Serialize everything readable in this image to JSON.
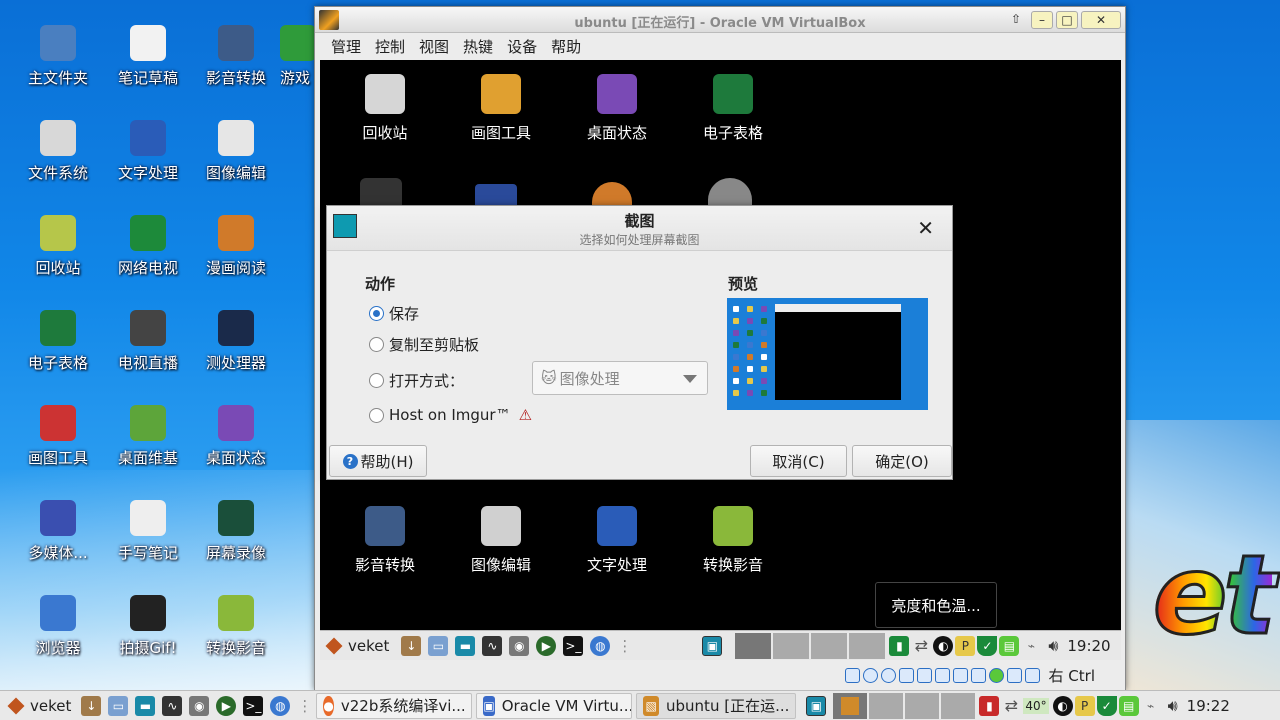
{
  "desktop": {
    "icons": [
      {
        "label": "主文件夹",
        "icon": "home-folder-icon",
        "color": "#4a7fc0"
      },
      {
        "label": "笔记草稿",
        "icon": "notes-icon",
        "color": "#f2f2f2"
      },
      {
        "label": "影音转换",
        "icon": "video-camera-icon",
        "color": "#3d5b88"
      },
      {
        "label": "游戏",
        "icon": "game-icon",
        "color": "#2f9b3a"
      },
      {
        "label": "文件系统",
        "icon": "drive-icon",
        "color": "#d8d8d8"
      },
      {
        "label": "文字处理",
        "icon": "word-icon",
        "color": "#2a5cb8"
      },
      {
        "label": "图像编辑",
        "icon": "paint-icon",
        "color": "#e6e6e6"
      },
      {
        "label": "回收站",
        "icon": "trash-icon",
        "color": "#b6c64a"
      },
      {
        "label": "网络电视",
        "icon": "play-icon",
        "color": "#1d8a3a"
      },
      {
        "label": "漫画阅读",
        "icon": "monkey-icon",
        "color": "#d07a2a"
      },
      {
        "label": "电子表格",
        "icon": "excel-icon",
        "color": "#1e7a3c"
      },
      {
        "label": "电视直播",
        "icon": "tv-reel-icon",
        "color": "#444444"
      },
      {
        "label": "测处理器",
        "icon": "cpu-icon",
        "color": "#1a2a4a"
      },
      {
        "label": "画图工具",
        "icon": "paint-tool-icon",
        "color": "#cc3333"
      },
      {
        "label": "桌面维基",
        "icon": "wiki-icon",
        "color": "#5da53a"
      },
      {
        "label": "桌面状态",
        "icon": "monitor-status-icon",
        "color": "#7a4ab5"
      },
      {
        "label": "多媒体...",
        "icon": "multimedia-icon",
        "color": "#3a4fb0"
      },
      {
        "label": "手写笔记",
        "icon": "handwriting-icon",
        "color": "#eeeeee"
      },
      {
        "label": "屏幕录像",
        "icon": "screen-record-icon",
        "color": "#1a4f3a"
      },
      {
        "label": "浏览器",
        "icon": "browser-icon",
        "color": "#3a78d0"
      },
      {
        "label": "拍摄Gif!",
        "icon": "gif-camera-icon",
        "color": "#222222"
      },
      {
        "label": "转换影音",
        "icon": "convert-media-icon",
        "color": "#8ab83a"
      }
    ],
    "logo_text": "et"
  },
  "vbox": {
    "title": "ubuntu [正在运行] - Oracle VM VirtualBox",
    "menu": [
      "管理",
      "控制",
      "视图",
      "热键",
      "设备",
      "帮助"
    ],
    "guest_icons_top": [
      {
        "label": "回收站",
        "icon": "trash-icon",
        "color": "#d6d6d6"
      },
      {
        "label": "画图工具",
        "icon": "paint-tool-icon",
        "color": "#e0a030"
      },
      {
        "label": "桌面状态",
        "icon": "monitor-status-icon",
        "color": "#7a4ab5"
      },
      {
        "label": "电子表格",
        "icon": "excel-icon",
        "color": "#1e7a3c"
      }
    ],
    "guest_icons_bottom": [
      {
        "label": "影音转换",
        "icon": "video-camera-icon",
        "color": "#3d5b88"
      },
      {
        "label": "图像编辑",
        "icon": "paint-icon",
        "color": "#d0d0d0"
      },
      {
        "label": "文字处理",
        "icon": "word-icon",
        "color": "#2a5cb8"
      },
      {
        "label": "转换影音",
        "icon": "convert-media-icon",
        "color": "#8ab83a"
      }
    ],
    "guest_taskbar": {
      "start": "veket",
      "time": "19:20"
    },
    "status_host_key": "右 Ctrl"
  },
  "tooltip": "亮度和色温...",
  "dialog": {
    "title": "截图",
    "subtitle": "选择如何处理屏幕截图",
    "action_heading": "动作",
    "preview_heading": "预览",
    "options": [
      {
        "label": "保存",
        "checked": true
      },
      {
        "label": "复制至剪贴板",
        "checked": false
      },
      {
        "label": "打开方式：",
        "checked": false
      },
      {
        "label": "Host on Imgur™",
        "checked": false
      }
    ],
    "open_with_value": "图像处理",
    "help_label": "帮助(H)",
    "cancel_label": "取消(C)",
    "ok_label": "确定(O)"
  },
  "host_taskbar": {
    "start": "veket",
    "tasks": [
      "v22b系统编译vi...",
      "Oracle VM Virtu...",
      "ubuntu [正在运..."
    ],
    "temp": "40°",
    "time": "19:22"
  }
}
